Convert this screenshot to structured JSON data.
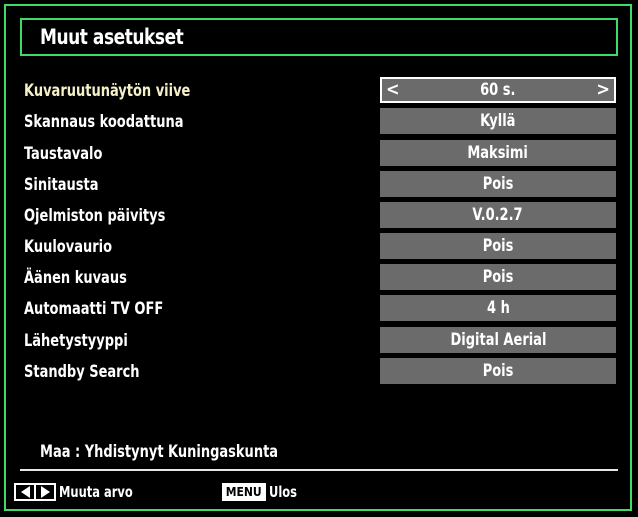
{
  "window": {
    "title": "Muut asetukset",
    "accent_color": "#3ddc6a"
  },
  "settings": [
    {
      "label": "Kuvaruutunäytön viive",
      "value": "60 s.",
      "selected": true
    },
    {
      "label": "Skannaus koodattuna",
      "value": "Kyllä"
    },
    {
      "label": "Taustavalo",
      "value": "Maksimi"
    },
    {
      "label": "Sinitausta",
      "value": "Pois"
    },
    {
      "label": "Ojelmiston päivitys",
      "value": "V.0.2.7"
    },
    {
      "label": "Kuulovaurio",
      "value": "Pois"
    },
    {
      "label": "Äänen kuvaus",
      "value": "Pois"
    },
    {
      "label": "Automaatti TV OFF",
      "value": "4 h"
    },
    {
      "label": "Lähetystyyppi",
      "value": "Digital Aerial"
    },
    {
      "label": "Standby Search",
      "value": "Pois"
    }
  ],
  "selector_icons": {
    "left": "chevron-left-icon",
    "right": "chevron-right-icon",
    "left_glyph": "<",
    "right_glyph": ">"
  },
  "country": "Maa : Yhdistynyt Kuningaskunta",
  "footer": {
    "change_value_label": "Muuta arvo",
    "menu_key_label": "MENU",
    "exit_label": "Ulos"
  }
}
